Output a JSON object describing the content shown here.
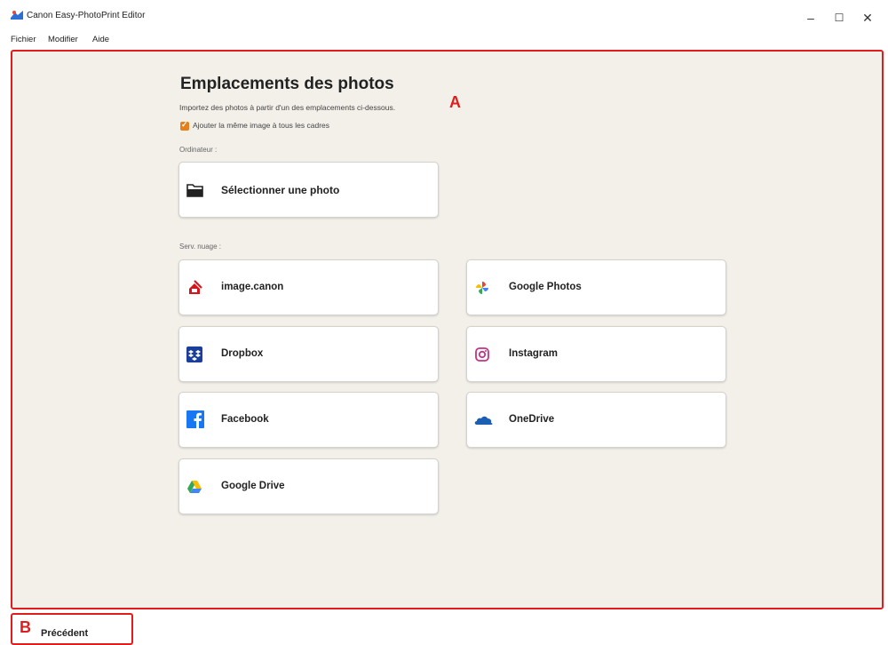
{
  "window": {
    "title": "Canon Easy-PhotoPrint Editor",
    "minimize_glyph": "–",
    "maximize_glyph": "☐",
    "close_glyph": "✕"
  },
  "menu": {
    "items": [
      "Fichier",
      "Modifier",
      "Aide"
    ]
  },
  "main": {
    "heading": "Emplacements des photos",
    "subtitle": "Importez des photos à partir d'un des emplacements ci-dessous.",
    "marker_a": "A",
    "same_image_checkbox": {
      "label": "Ajouter la même image à tous les cadres",
      "checked": true,
      "color": "#e6801e"
    },
    "computer_section": {
      "label": "Ordinateur :",
      "select_photo": {
        "label": "Sélectionner une photo",
        "icon": "folder-icon"
      }
    },
    "cloud_section": {
      "label": "Serv. nuage :",
      "services": [
        {
          "label": "image.canon",
          "icon": "image-canon-icon"
        },
        {
          "label": "Google Photos",
          "icon": "google-photos-icon"
        },
        {
          "label": "Dropbox",
          "icon": "dropbox-icon"
        },
        {
          "label": "Instagram",
          "icon": "instagram-icon"
        },
        {
          "label": "Facebook",
          "icon": "facebook-icon"
        },
        {
          "label": "OneDrive",
          "icon": "onedrive-icon"
        },
        {
          "label": "Google Drive",
          "icon": "google-drive-icon"
        }
      ]
    }
  },
  "footer": {
    "marker_b": "B",
    "back_label": "Précédent"
  },
  "colors": {
    "highlight_border": "#e21c1c",
    "panel_background": "#f3f0ea",
    "checkbox": "#e6801e"
  }
}
